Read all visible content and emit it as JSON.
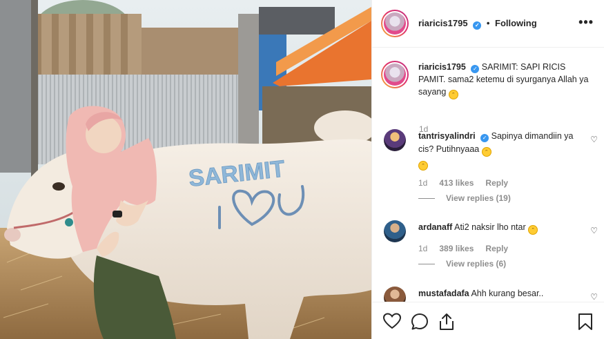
{
  "post": {
    "username": "riaricis1795",
    "follow_separator": "•",
    "follow_status": "Following",
    "more_label": "•••",
    "verified_mark": "✓"
  },
  "caption": {
    "username": "riaricis1795",
    "text": "SARIMIT: SAPI RICIS PAMIT. sama2 ketemu di syurganya Allah ya sayang",
    "emoji": "😅",
    "time": "1d"
  },
  "comments": [
    {
      "username": "tantrisyalindri",
      "verified": true,
      "text": "Sapinya dimandiin ya cis? Putihnyaaa",
      "emojis": "🤣 🤣",
      "time": "1d",
      "likes": "413 likes",
      "reply_label": "Reply",
      "view_replies": "View replies (19)",
      "avatar_color": "#5a3b7a"
    },
    {
      "username": "ardanaff",
      "verified": false,
      "text": "Ati2 naksir lho ntar",
      "emojis": "😂",
      "time": "1d",
      "likes": "389 likes",
      "reply_label": "Reply",
      "view_replies": "View replies (6)",
      "avatar_color": "#2f5f8a"
    },
    {
      "username": "mustafadafa",
      "verified": false,
      "text": "Ahh kurang besar..",
      "avatar_color": "#8a5a3c"
    }
  ],
  "photo": {
    "painted_text": "SARIMIT",
    "painted_text_2": "I ♡ U"
  },
  "colors": {
    "accent": "#3897f0",
    "muted": "#8e8e8e",
    "text": "#262626"
  },
  "icons": [
    "heart-icon",
    "comment-icon",
    "share-icon",
    "bookmark-icon",
    "more-icon",
    "verified-icon"
  ]
}
